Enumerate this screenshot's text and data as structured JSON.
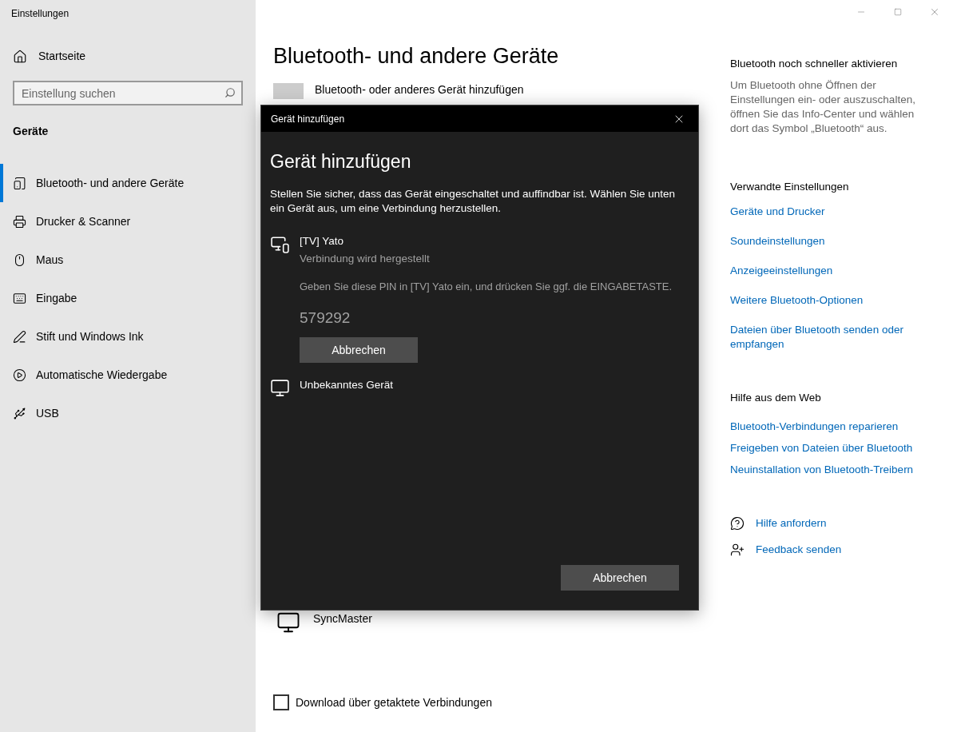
{
  "window": {
    "title": "Einstellungen"
  },
  "sidebar": {
    "home": "Startseite",
    "search": {
      "placeholder": "Einstellung suchen"
    },
    "section": "Geräte",
    "items": [
      {
        "kind": "bluetooth",
        "label": "Bluetooth- und andere Geräte",
        "selected": true
      },
      {
        "kind": "printer",
        "label": "Drucker & Scanner",
        "selected": false
      },
      {
        "kind": "mouse",
        "label": "Maus",
        "selected": false
      },
      {
        "kind": "keyboard",
        "label": "Eingabe",
        "selected": false
      },
      {
        "kind": "pen",
        "label": "Stift und Windows Ink",
        "selected": false
      },
      {
        "kind": "autoplay",
        "label": "Automatische Wiedergabe",
        "selected": false
      },
      {
        "kind": "usb",
        "label": "USB",
        "selected": false
      }
    ]
  },
  "main": {
    "title": "Bluetooth- und andere Geräte",
    "add_device": "Bluetooth- oder anderes Gerät hinzufügen",
    "devices": [
      {
        "kind": "monitor",
        "name": "SyncMaster"
      }
    ],
    "metered_download": {
      "label": "Download über getaktete Verbindungen",
      "checked": false
    }
  },
  "right_panel": {
    "tip": {
      "heading": "Bluetooth noch schneller aktivieren",
      "text": "Um Bluetooth ohne Öffnen der Einstellungen ein- oder auszuschalten, öffnen Sie das Info-Center und wählen dort das Symbol „Bluetooth“ aus."
    },
    "related": {
      "heading": "Verwandte Einstellungen",
      "links": [
        "Geräte und Drucker",
        "Soundeinstellungen",
        "Anzeigeeinstellungen",
        "Weitere Bluetooth-Optionen",
        "Dateien über Bluetooth senden oder empfangen"
      ]
    },
    "web_help": {
      "heading": "Hilfe aus dem Web",
      "links": [
        "Bluetooth-Verbindungen reparieren",
        "Freigeben von Dateien über Bluetooth",
        "Neuinstallation von Bluetooth-Treibern"
      ]
    },
    "actions": [
      {
        "kind": "help",
        "label": "Hilfe anfordern"
      },
      {
        "kind": "feedback",
        "label": "Feedback senden"
      }
    ]
  },
  "dialog": {
    "title": "Gerät hinzufügen",
    "heading": "Gerät hinzufügen",
    "instructions": "Stellen Sie sicher, dass das Gerät eingeschaltet und auffindbar ist. Wählen Sie unten ein Gerät aus, um eine Verbindung herzustellen.",
    "devices": [
      {
        "kind": "display",
        "name": "[TV] Yato",
        "status": "Verbindung wird hergestellt",
        "pin_prompt": "Geben Sie diese PIN in [TV] Yato ein, und drücken Sie ggf. die EINGABETASTE.",
        "pin": "579292",
        "cancel": "Abbrechen"
      },
      {
        "kind": "monitor",
        "name": "Unbekanntes Gerät"
      }
    ],
    "cancel": "Abbrechen"
  }
}
